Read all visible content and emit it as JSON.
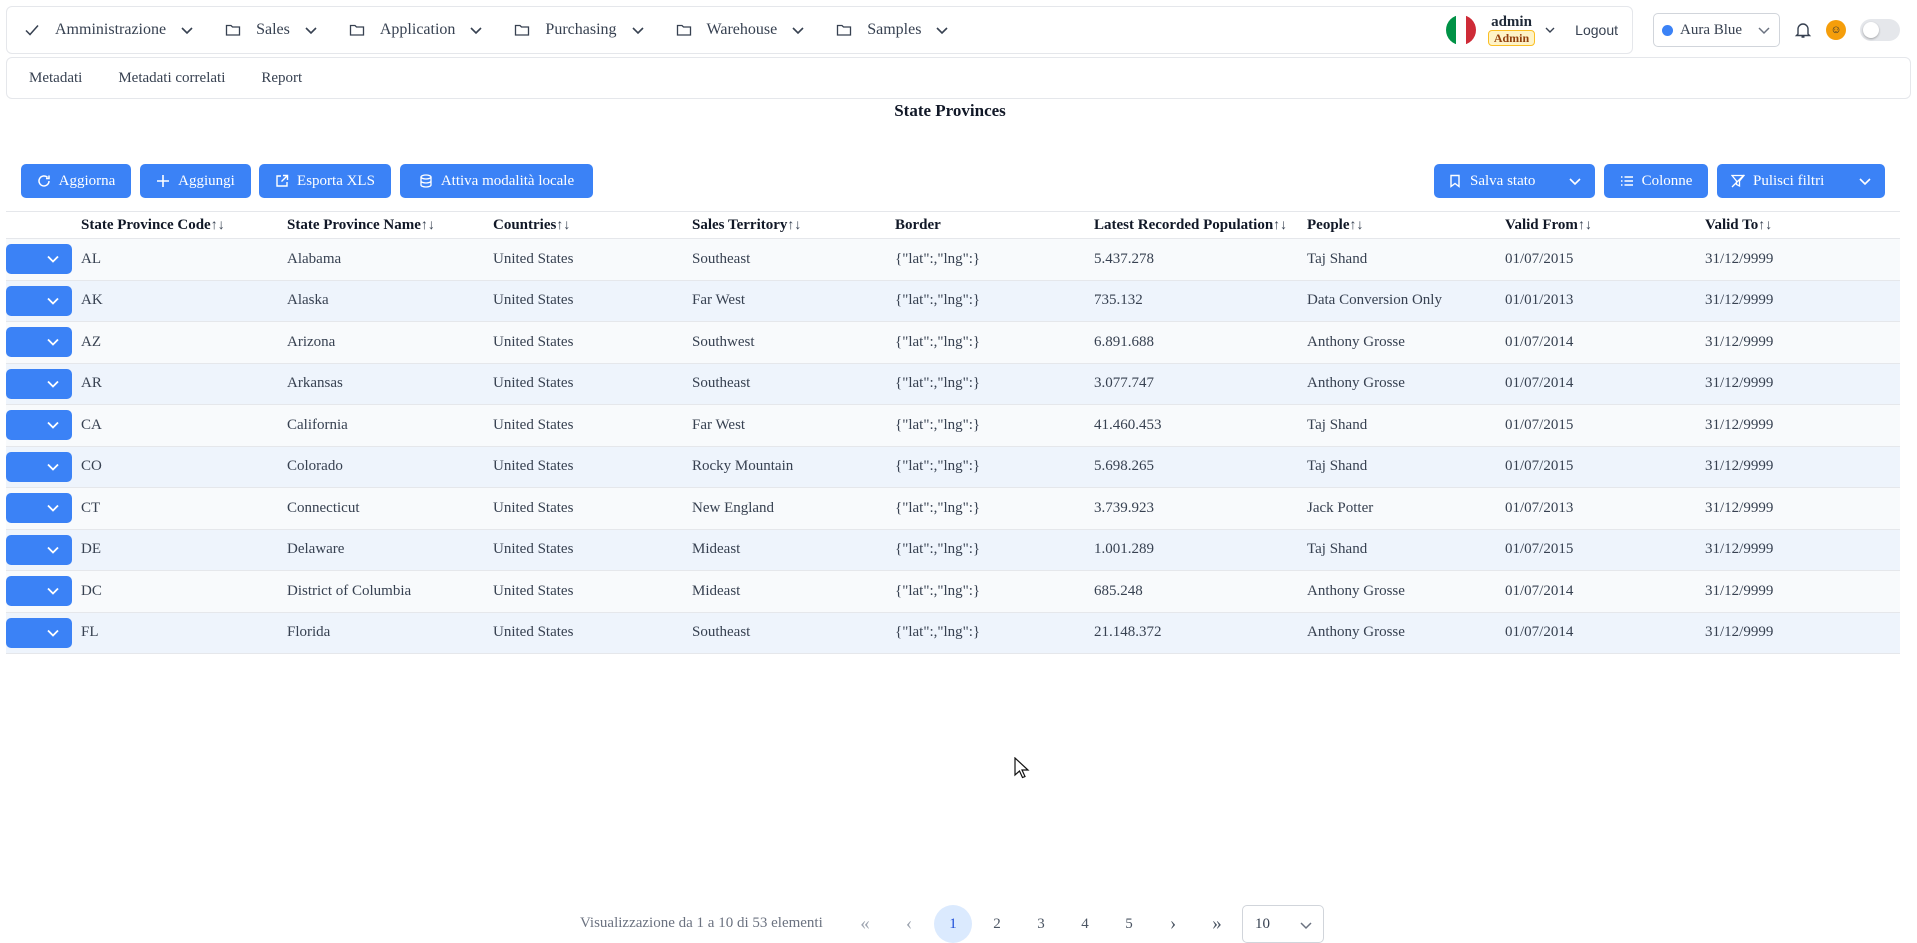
{
  "nav": {
    "items": [
      {
        "label": "Amministrazione",
        "icon": "check-icon"
      },
      {
        "label": "Sales",
        "icon": "folder-icon"
      },
      {
        "label": "Application",
        "icon": "folder-icon"
      },
      {
        "label": "Purchasing",
        "icon": "folder-icon"
      },
      {
        "label": "Warehouse",
        "icon": "folder-icon"
      },
      {
        "label": "Samples",
        "icon": "folder-icon"
      }
    ],
    "user_name": "admin",
    "user_role": "Admin",
    "logout_label": "Logout",
    "theme": "Aura Blue"
  },
  "subnav": {
    "items": [
      "Metadati",
      "Metadati correlati",
      "Report"
    ]
  },
  "page_title": "State Provinces",
  "toolbar": {
    "refresh_label": "Aggiorna",
    "add_label": "Aggiungi",
    "export_label": "Esporta XLS",
    "local_mode_label": "Attiva modalità locale",
    "save_state_label": "Salva stato",
    "columns_label": "Colonne",
    "clear_filters_label": "Pulisci filtri"
  },
  "table": {
    "sort_glyph": "↑↓",
    "columns": [
      "State Province Code",
      "State Province Name",
      "Countries",
      "Sales Territory",
      "Border",
      "Latest Recorded Population",
      "People",
      "Valid From",
      "Valid To"
    ],
    "rows": [
      [
        "AL",
        "Alabama",
        "United States",
        "Southeast",
        "{\"lat\":,\"lng\":}",
        "5.437.278",
        "Taj Shand",
        "01/07/2015",
        "31/12/9999"
      ],
      [
        "AK",
        "Alaska",
        "United States",
        "Far West",
        "{\"lat\":,\"lng\":}",
        "735.132",
        "Data Conversion Only",
        "01/01/2013",
        "31/12/9999"
      ],
      [
        "AZ",
        "Arizona",
        "United States",
        "Southwest",
        "{\"lat\":,\"lng\":}",
        "6.891.688",
        "Anthony Grosse",
        "01/07/2014",
        "31/12/9999"
      ],
      [
        "AR",
        "Arkansas",
        "United States",
        "Southeast",
        "{\"lat\":,\"lng\":}",
        "3.077.747",
        "Anthony Grosse",
        "01/07/2014",
        "31/12/9999"
      ],
      [
        "CA",
        "California",
        "United States",
        "Far West",
        "{\"lat\":,\"lng\":}",
        "41.460.453",
        "Taj Shand",
        "01/07/2015",
        "31/12/9999"
      ],
      [
        "CO",
        "Colorado",
        "United States",
        "Rocky Mountain",
        "{\"lat\":,\"lng\":}",
        "5.698.265",
        "Taj Shand",
        "01/07/2015",
        "31/12/9999"
      ],
      [
        "CT",
        "Connecticut",
        "United States",
        "New England",
        "{\"lat\":,\"lng\":}",
        "3.739.923",
        "Jack Potter",
        "01/07/2013",
        "31/12/9999"
      ],
      [
        "DE",
        "Delaware",
        "United States",
        "Mideast",
        "{\"lat\":,\"lng\":}",
        "1.001.289",
        "Taj Shand",
        "01/07/2015",
        "31/12/9999"
      ],
      [
        "DC",
        "District of Columbia",
        "United States",
        "Mideast",
        "{\"lat\":,\"lng\":}",
        "685.248",
        "Anthony Grosse",
        "01/07/2014",
        "31/12/9999"
      ],
      [
        "FL",
        "Florida",
        "United States",
        "Southeast",
        "{\"lat\":,\"lng\":}",
        "21.148.372",
        "Anthony Grosse",
        "01/07/2014",
        "31/12/9999"
      ]
    ]
  },
  "pagination": {
    "info": "Visualizzazione da 1 a 10 di 53 elementi",
    "first": "«",
    "prev": "‹",
    "pages": [
      "1",
      "2",
      "3",
      "4",
      "5"
    ],
    "next": "›",
    "last": "»",
    "rows_per_page": "10"
  },
  "colors": {
    "primary": "#3b82f6",
    "row_odd": "#f8fafc",
    "row_even": "#eef4fc"
  }
}
